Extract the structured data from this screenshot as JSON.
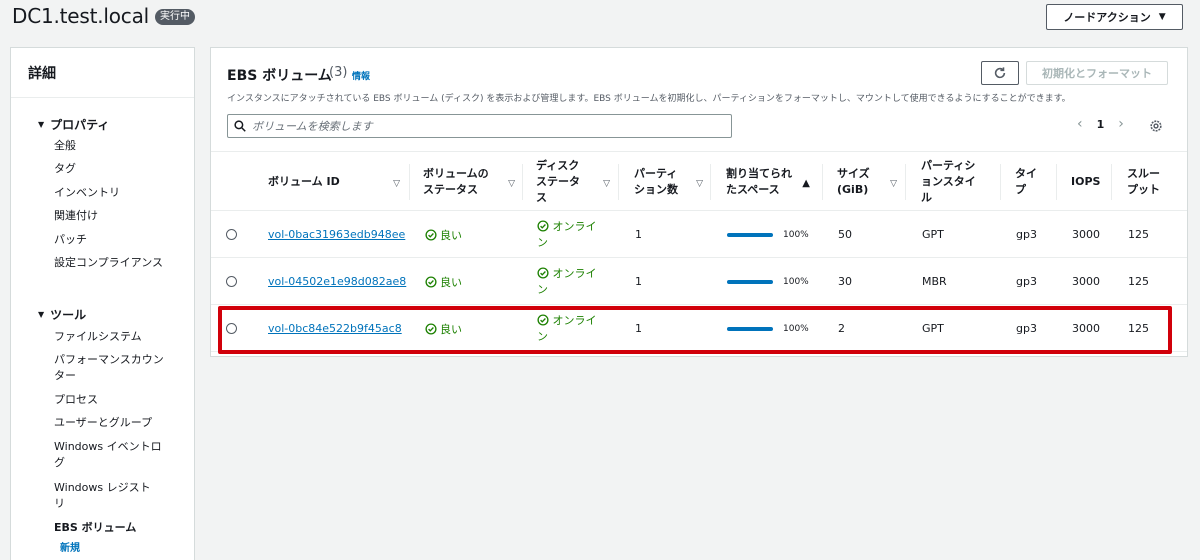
{
  "header": {
    "title": "DC1.test.local",
    "status": "実行中",
    "node_action_label": "ノードアクション"
  },
  "sidebar": {
    "heading": "詳細",
    "sections": [
      {
        "label": "プロパティ",
        "items": [
          "全般",
          "タグ",
          "インベントリ",
          "関連付け",
          "パッチ",
          "設定コンプライアンス"
        ]
      },
      {
        "label": "ツール",
        "items": [
          "ファイルシステム",
          "パフォーマンスカウンター",
          "プロセス",
          "ユーザーとグループ",
          "Windows イベントログ",
          "Windows レジストリ",
          "EBS ボリューム"
        ]
      }
    ],
    "new_badge": "新規"
  },
  "panel": {
    "title": "EBS ボリューム",
    "count": "(3)",
    "info_label": "情報",
    "description": "インスタンスにアタッチされている EBS ボリューム (ディスク) を表示および管理します。EBS ボリュームを初期化し、パーティションをフォーマットし、マウントして使用できるようにすることができます。",
    "init_button_label": "初期化とフォーマット",
    "search_placeholder": "ボリュームを検索します",
    "page_number": "1"
  },
  "table": {
    "columns": {
      "volume_id": "ボリューム ID",
      "volume_status": "ボリュームのステータス",
      "disk_status": "ディスクステータス",
      "partitions": "パーティション数",
      "allocated": "割り当てられたスペース",
      "size": "サイズ (GiB)",
      "partition_style": "パーティションスタイル",
      "type": "タイプ",
      "iops": "IOPS",
      "throughput": "スループット"
    },
    "rows": [
      {
        "volume_id": "vol-0bac31963edb948ee",
        "volume_status": "良い",
        "disk_status": "オンライン",
        "partitions": "1",
        "allocated_pct": "100%",
        "allocated_fraction": 1.0,
        "size": "50",
        "partition_style": "GPT",
        "type": "gp3",
        "iops": "3000",
        "throughput": "125"
      },
      {
        "volume_id": "vol-04502e1e98d082ae8",
        "volume_status": "良い",
        "disk_status": "オンライン",
        "partitions": "1",
        "allocated_pct": "100%",
        "allocated_fraction": 1.0,
        "size": "30",
        "partition_style": "MBR",
        "type": "gp3",
        "iops": "3000",
        "throughput": "125"
      },
      {
        "volume_id": "vol-0bc84e522b9f45ac8",
        "volume_status": "良い",
        "disk_status": "オンライン",
        "partitions": "1",
        "allocated_pct": "100%",
        "allocated_fraction": 1.0,
        "size": "2",
        "partition_style": "GPT",
        "type": "gp3",
        "iops": "3000",
        "throughput": "125"
      }
    ]
  },
  "colors": {
    "link": "#0073bb",
    "success": "#1d8102",
    "highlight": "#d1000a",
    "status_pill": "#545b64"
  }
}
